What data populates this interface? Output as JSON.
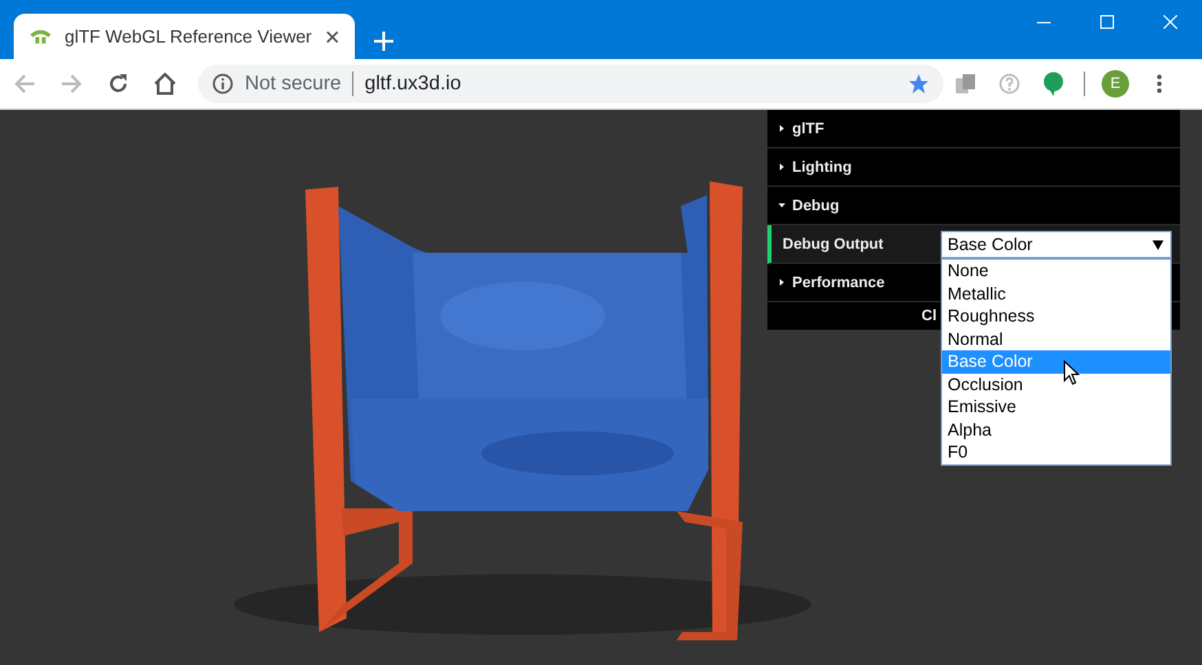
{
  "tab": {
    "title": "glTF WebGL Reference Viewer"
  },
  "address": {
    "security": "Not secure",
    "url": "gltf.ux3d.io"
  },
  "profile": {
    "initial": "E"
  },
  "panel": {
    "sections": [
      {
        "label": "glTF",
        "expanded": false
      },
      {
        "label": "Lighting",
        "expanded": false
      },
      {
        "label": "Debug",
        "expanded": true,
        "controls": [
          {
            "label": "Debug Output",
            "value": "Base Color",
            "open": true,
            "options": [
              {
                "label": "None",
                "selected": false
              },
              {
                "label": "Metallic",
                "selected": false
              },
              {
                "label": "Roughness",
                "selected": false
              },
              {
                "label": "Normal",
                "selected": false
              },
              {
                "label": "Base Color",
                "selected": true
              },
              {
                "label": "Occlusion",
                "selected": false
              },
              {
                "label": "Emissive",
                "selected": false
              },
              {
                "label": "Alpha",
                "selected": false
              },
              {
                "label": "F0",
                "selected": false
              }
            ]
          }
        ]
      },
      {
        "label": "Performance",
        "expanded": false
      }
    ],
    "close_button": "Cl"
  }
}
